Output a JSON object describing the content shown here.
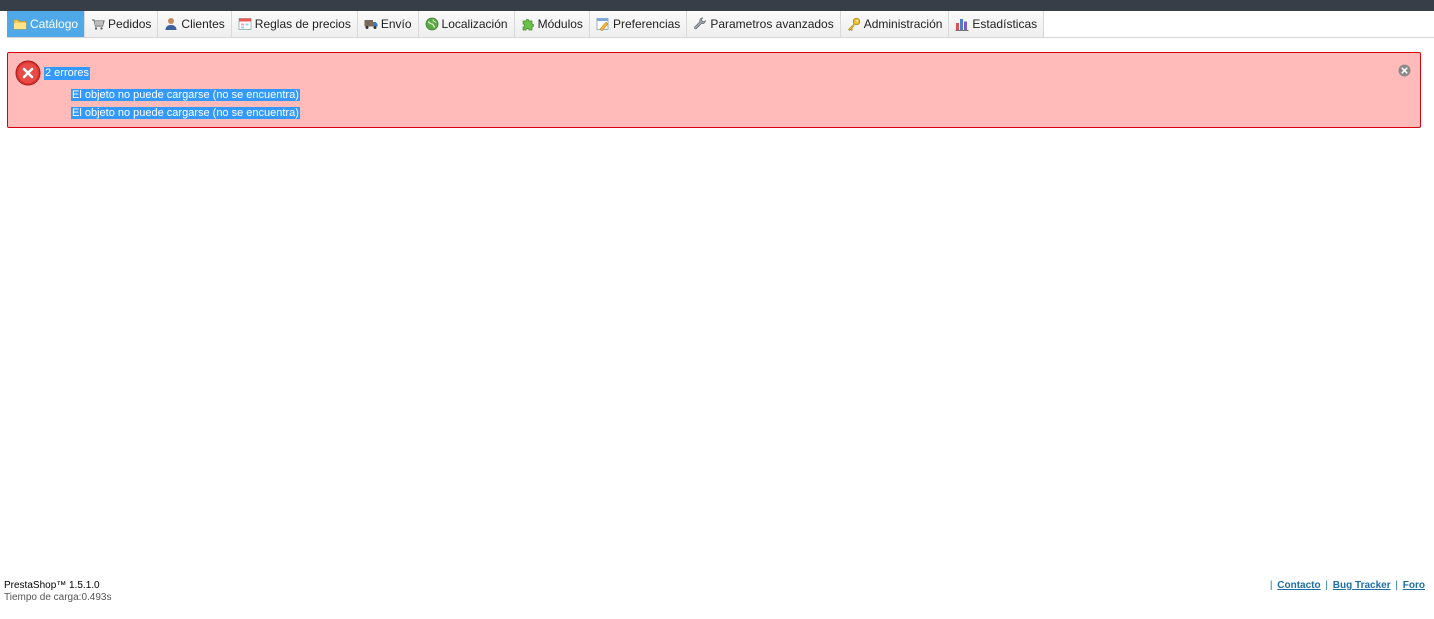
{
  "tabs": [
    {
      "label": "Catálogo",
      "icon": "folder-icon",
      "active": true
    },
    {
      "label": "Pedidos",
      "icon": "cart-icon",
      "active": false
    },
    {
      "label": "Clientes",
      "icon": "user-icon",
      "active": false
    },
    {
      "label": "Reglas de precios",
      "icon": "price-rules-icon",
      "active": false
    },
    {
      "label": "Envío",
      "icon": "truck-icon",
      "active": false
    },
    {
      "label": "Localización",
      "icon": "globe-icon",
      "active": false
    },
    {
      "label": "Módulos",
      "icon": "puzzle-icon",
      "active": false
    },
    {
      "label": "Preferencias",
      "icon": "preferences-icon",
      "active": false
    },
    {
      "label": "Parametros avanzados",
      "icon": "wrench-icon",
      "active": false
    },
    {
      "label": "Administración",
      "icon": "key-icon",
      "active": false
    },
    {
      "label": "Estadísticas",
      "icon": "bar-chart-icon",
      "active": false
    }
  ],
  "error": {
    "title": "2 errores",
    "items": [
      "El objeto no puede cargarse (no se encuentra)",
      "El objeto no puede cargarse (no se encuentra)"
    ]
  },
  "footer": {
    "version": "PrestaShop™ 1.5.1.0",
    "load_time": "Tiempo de carga:0.493s",
    "links": [
      "Contacto",
      "Bug Tracker",
      "Foro"
    ],
    "separator": "|"
  },
  "colors": {
    "active_tab": "#4fa9e8",
    "error_bg": "#ffbaba",
    "error_border": "#d8000c",
    "selection": "#3399ff",
    "link": "#1d6fa5"
  }
}
